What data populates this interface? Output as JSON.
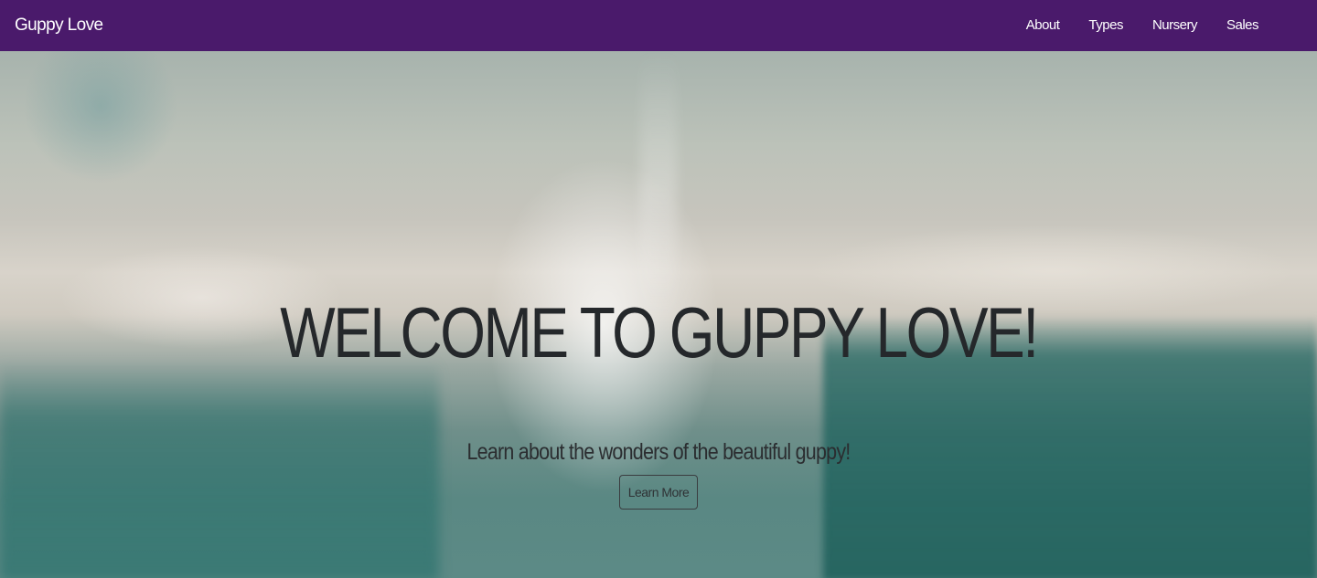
{
  "navbar": {
    "brand": "Guppy Love",
    "links": [
      {
        "label": "About"
      },
      {
        "label": "Types"
      },
      {
        "label": "Nursery"
      },
      {
        "label": "Sales"
      }
    ],
    "background_color": "#4a1a6b"
  },
  "hero": {
    "title": "WELCOME TO GUPPY LOVE!",
    "subtitle": "Learn about the wonders of the beautiful guppy!",
    "button_label": "Learn More",
    "background_image": "blurred aquarium photo with teal sponge filter"
  }
}
